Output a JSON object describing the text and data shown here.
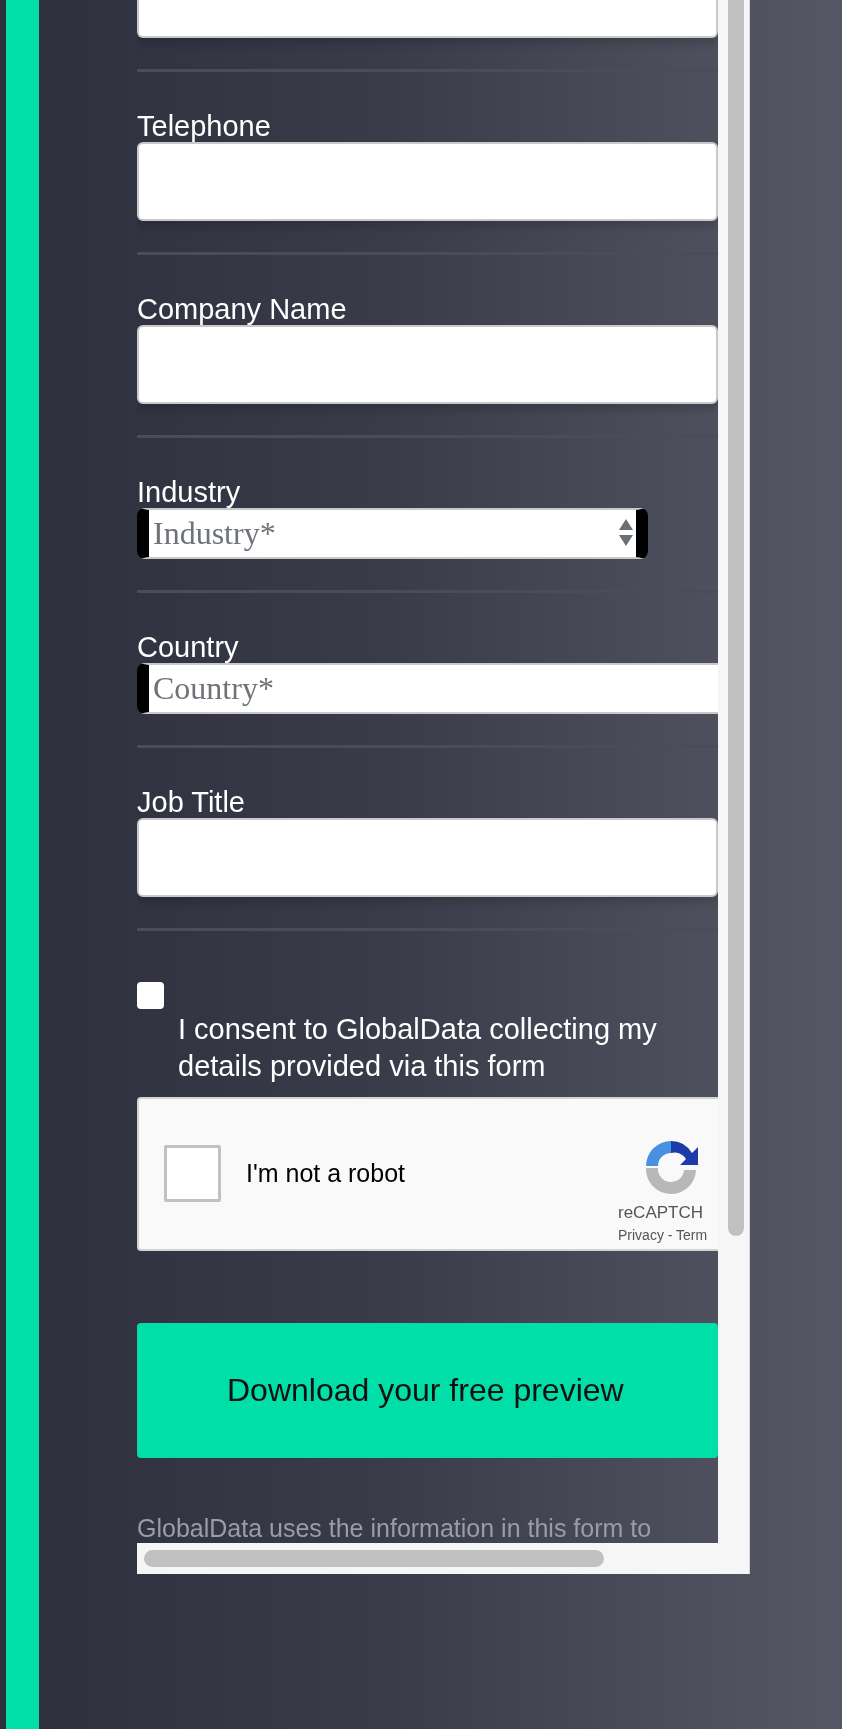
{
  "fields": [
    {
      "kind": "text",
      "cut_top": true
    },
    {
      "kind": "text",
      "label": "Telephone"
    },
    {
      "kind": "text",
      "label": "Company Name"
    },
    {
      "kind": "select",
      "label": "Industry",
      "placeholder": "Industry*",
      "cut": false
    },
    {
      "kind": "select",
      "label": "Country",
      "placeholder": "Country*",
      "cut": true
    },
    {
      "kind": "text",
      "label": "Job Title"
    }
  ],
  "consent": {
    "checked": false,
    "text": "I consent to GlobalData collecting my details provided via this form"
  },
  "captcha": {
    "checked": false,
    "label": "I'm not a robot",
    "brand": "reCAPTCH",
    "links": "Privacy - Term"
  },
  "submit": {
    "label": "Download your free preview"
  },
  "footer_text": "GlobalData uses the information in this form to"
}
